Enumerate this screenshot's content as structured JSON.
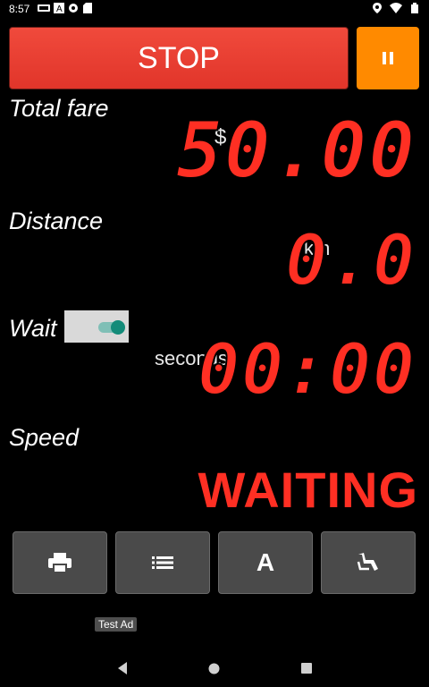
{
  "statusbar": {
    "time": "8:57",
    "left_icons": [
      "taxi-app-icon",
      "a-icon",
      "settings-icon",
      "sd-card-icon"
    ],
    "right_icons": [
      "location-icon",
      "wifi-icon",
      "battery-icon"
    ]
  },
  "controls": {
    "stop_label": "STOP",
    "pause_icon": "pause-icon"
  },
  "fare": {
    "label": "Total fare",
    "currency": "$",
    "value": "50.00"
  },
  "distance": {
    "label": "Distance",
    "unit": "km",
    "value": "0.0"
  },
  "wait": {
    "label": "Wait",
    "toggle_on": true,
    "unit": "seconds",
    "value": "00:00"
  },
  "speed": {
    "label": "Speed",
    "status": "WAITING"
  },
  "actions": [
    {
      "icon": "print-icon"
    },
    {
      "icon": "list-icon"
    },
    {
      "icon": "font-icon",
      "glyph": "A"
    },
    {
      "icon": "seat-icon"
    }
  ],
  "ad": {
    "label": "Test Ad"
  },
  "navbar": [
    "back-icon",
    "home-icon",
    "recents-icon"
  ],
  "colors": {
    "stop": "#e83a2e",
    "pause": "#ff8a00",
    "segment": "#ff2f23",
    "toggle": "#138b79",
    "button": "#4a4a4a"
  }
}
